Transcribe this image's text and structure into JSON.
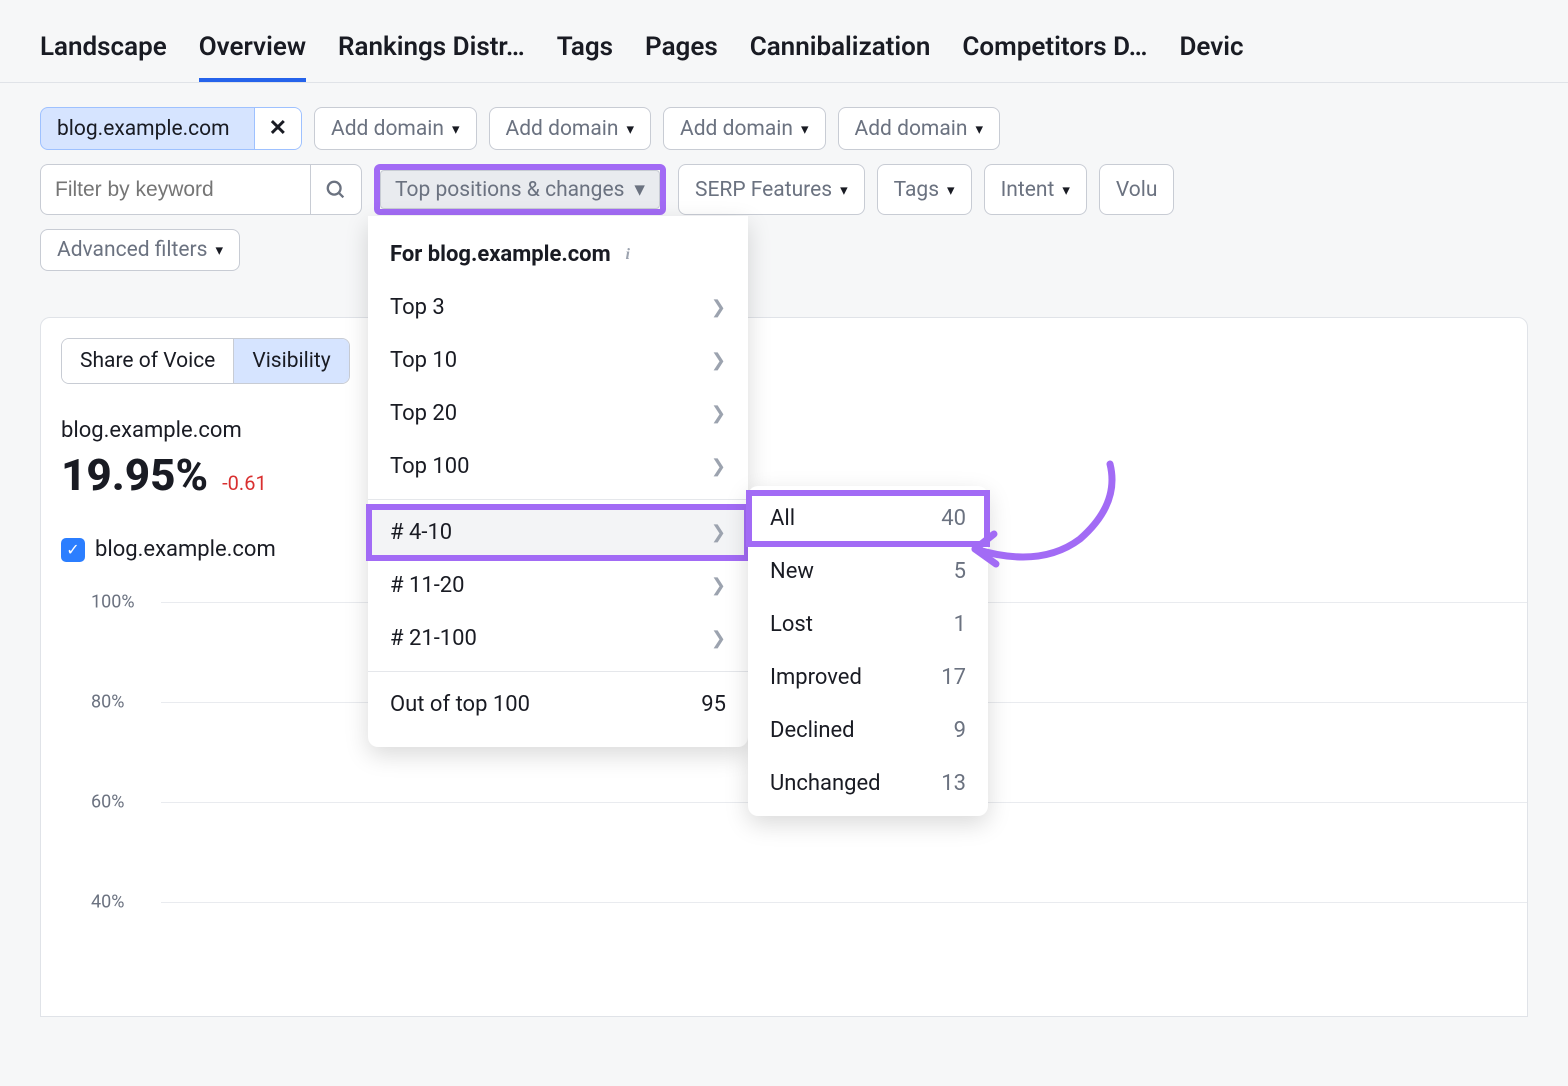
{
  "tabs": [
    "Landscape",
    "Overview",
    "Rankings Distr…",
    "Tags",
    "Pages",
    "Cannibalization",
    "Competitors D…",
    "Devic"
  ],
  "active_tab": "Overview",
  "domain_chip": "blog.example.com",
  "add_domain_label": "Add domain",
  "search_placeholder": "Filter by keyword",
  "filter_positions": "Top positions & changes",
  "filter_serp": "SERP Features",
  "filter_tags": "Tags",
  "filter_intent": "Intent",
  "filter_volume": "Volu",
  "advanced_filters": "Advanced filters",
  "subtabs": {
    "sov": "Share of Voice",
    "vis": "Visibility"
  },
  "metric": {
    "domain": "blog.example.com",
    "value": "19.95%",
    "delta": "-0.61"
  },
  "legend_domain": "blog.example.com",
  "y_ticks": [
    "100%",
    "80%",
    "60%",
    "40%"
  ],
  "dropdown": {
    "header_prefix": "For ",
    "header_domain": "blog.example.com",
    "items_a": [
      "Top 3",
      "Top 10",
      "Top 20",
      "Top 100"
    ],
    "items_b": [
      "# 4-10",
      "# 11-20",
      "# 21-100"
    ],
    "highlighted_b": "# 4-10",
    "out_label": "Out of top 100",
    "out_count": "95"
  },
  "submenu": [
    {
      "label": "All",
      "count": "40"
    },
    {
      "label": "New",
      "count": "5"
    },
    {
      "label": "Lost",
      "count": "1"
    },
    {
      "label": "Improved",
      "count": "17"
    },
    {
      "label": "Declined",
      "count": "9"
    },
    {
      "label": "Unchanged",
      "count": "13"
    }
  ],
  "chart_data": {
    "type": "line",
    "title": "Visibility",
    "ylabel": "",
    "ylim": [
      0,
      100
    ],
    "y_ticks": [
      40,
      60,
      80,
      100
    ],
    "series": [
      {
        "name": "blog.example.com",
        "values": []
      }
    ]
  }
}
